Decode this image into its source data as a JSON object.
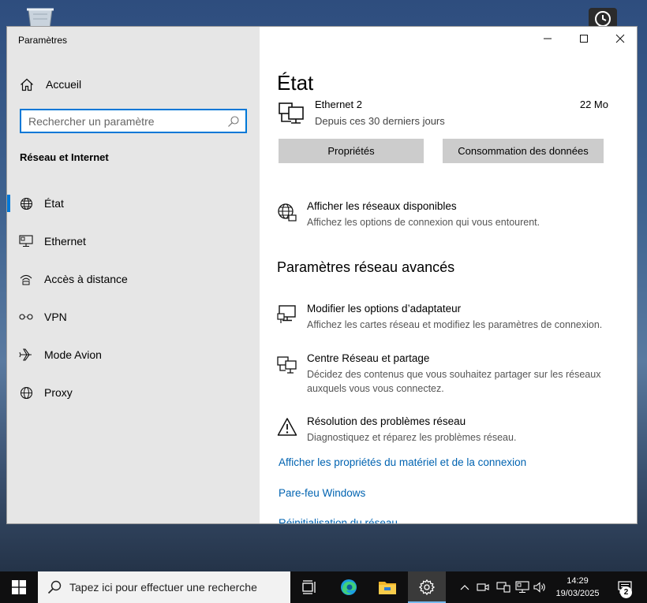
{
  "window": {
    "app_title": "Paramètres"
  },
  "sidebar": {
    "home_label": "Accueil",
    "search_placeholder": "Rechercher un paramètre",
    "search_value": "",
    "category": "Réseau et Internet",
    "items": [
      {
        "label": "État",
        "icon": "globe-icon",
        "active": true
      },
      {
        "label": "Ethernet",
        "icon": "monitor-network-icon"
      },
      {
        "label": "Accès à distance",
        "icon": "dialup-icon"
      },
      {
        "label": "VPN",
        "icon": "vpn-icon"
      },
      {
        "label": "Mode Avion",
        "icon": "airplane-icon"
      },
      {
        "label": "Proxy",
        "icon": "globe-icon"
      }
    ]
  },
  "main": {
    "title": "État",
    "ethernet": {
      "name": "Ethernet 2",
      "subtitle": "Depuis ces 30 derniers jours",
      "usage": "22 Mo"
    },
    "buttons": {
      "properties": "Propriétés",
      "data_usage": "Consommation des données"
    },
    "show_networks": {
      "title": "Afficher les réseaux disponibles",
      "desc": "Affichez les options de connexion qui vous entourent."
    },
    "advanced_heading": "Paramètres réseau avancés",
    "adapter": {
      "title": "Modifier les options d’adaptateur",
      "desc": "Affichez les cartes réseau et modifiez les paramètres de connexion."
    },
    "sharing": {
      "title": "Centre Réseau et partage",
      "desc": "Décidez des contenus que vous souhaitez partager sur les réseaux auxquels vous vous connectez."
    },
    "troubleshoot": {
      "title": "Résolution des problèmes réseau",
      "desc": "Diagnostiquez et réparez les problèmes réseau."
    },
    "links": {
      "hardware": "Afficher les propriétés du matériel et de la connexion",
      "firewall": "Pare-feu Windows",
      "reset": "Réinitialisation du réseau"
    }
  },
  "taskbar": {
    "search_placeholder": "Tapez ici pour effectuer une recherche",
    "time": "14:29",
    "date": "19/03/2025",
    "notification_count": "2"
  },
  "colors": {
    "accent": "#0078d7",
    "link": "#0063b1",
    "sidebar_bg": "#e6e6e6",
    "button_bg": "#cccccc",
    "taskbar": "#0f0f10"
  }
}
